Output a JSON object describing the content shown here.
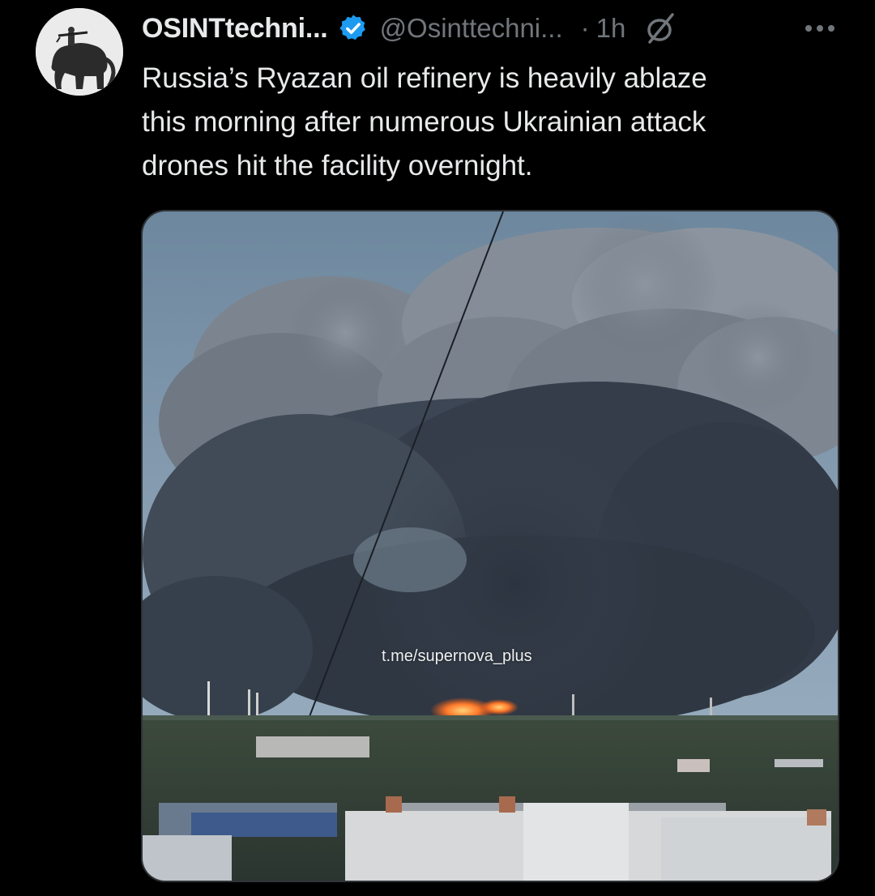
{
  "author": {
    "display_name": "OSINTtechni...",
    "handle": "@Osinttechni...",
    "separator": "·",
    "time": "1h"
  },
  "tweet": {
    "text": "Russia’s Ryazan oil refinery is heavily ablaze\nthis morning after numerous Ukrainian attack\ndrones hit the facility overnight."
  },
  "media": {
    "watermark": "t.me/supernova_plus"
  },
  "icons": {
    "verified": "verified-badge-icon",
    "grok": "grok-icon",
    "more": "more-options-icon"
  },
  "colors": {
    "background": "#000000",
    "text": "#e7e9ea",
    "secondary": "#71767b",
    "verified_blue": "#1d9bf0"
  }
}
